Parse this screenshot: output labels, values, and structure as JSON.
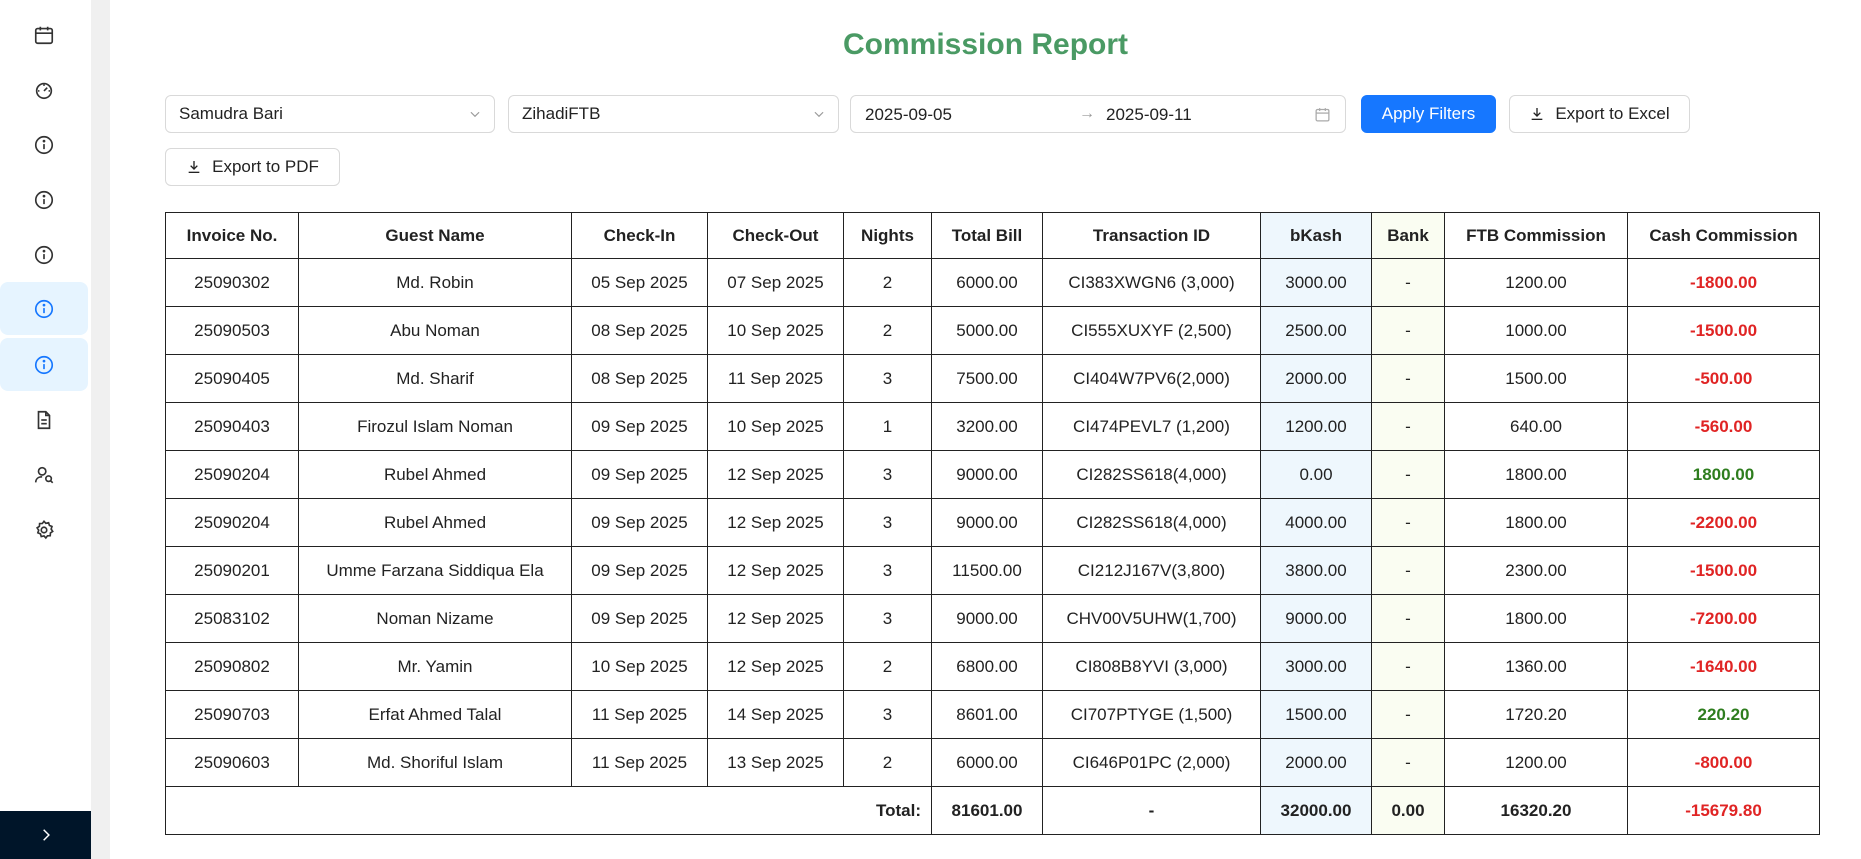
{
  "page": {
    "title": "Commission Report"
  },
  "filters": {
    "property": "Samudra Bari",
    "agent": "ZihadiFTB",
    "date_from": "2025-09-05",
    "date_arrow": "→",
    "date_to": "2025-09-11",
    "apply_label": "Apply Filters",
    "export_excel_label": "Export to Excel",
    "export_pdf_label": "Export to PDF"
  },
  "sidebar": {
    "items": [
      {
        "icon": "calendar-icon"
      },
      {
        "icon": "dashboard-icon"
      },
      {
        "icon": "info-icon"
      },
      {
        "icon": "info-icon"
      },
      {
        "icon": "info-icon"
      },
      {
        "icon": "info-icon",
        "active": true
      },
      {
        "icon": "info-icon",
        "active": true
      },
      {
        "icon": "file-text-icon"
      },
      {
        "icon": "user-search-icon"
      },
      {
        "icon": "settings-icon"
      }
    ],
    "footer_icon": "chevron-right-icon"
  },
  "table": {
    "headers": [
      "Invoice No.",
      "Guest Name",
      "Check-In",
      "Check-Out",
      "Nights",
      "Total Bill",
      "Transaction ID",
      "bKash",
      "Bank",
      "FTB Commission",
      "Cash Commission"
    ],
    "rows": [
      {
        "invoice": "25090302",
        "guest": "Md. Robin",
        "checkin": "05 Sep 2025",
        "checkout": "07 Sep 2025",
        "nights": "2",
        "total": "6000.00",
        "txn": "CI383XWGN6 (3,000)",
        "bkash": "3000.00",
        "bank": "-",
        "ftb": "1200.00",
        "cash": "-1800.00"
      },
      {
        "invoice": "25090503",
        "guest": "Abu Noman",
        "checkin": "08 Sep 2025",
        "checkout": "10 Sep 2025",
        "nights": "2",
        "total": "5000.00",
        "txn": "CI555XUXYF (2,500)",
        "bkash": "2500.00",
        "bank": "-",
        "ftb": "1000.00",
        "cash": "-1500.00"
      },
      {
        "invoice": "25090405",
        "guest": "Md. Sharif",
        "checkin": "08 Sep 2025",
        "checkout": "11 Sep 2025",
        "nights": "3",
        "total": "7500.00",
        "txn": "CI404W7PV6(2,000)",
        "bkash": "2000.00",
        "bank": "-",
        "ftb": "1500.00",
        "cash": "-500.00"
      },
      {
        "invoice": "25090403",
        "guest": "Firozul Islam Noman",
        "checkin": "09 Sep 2025",
        "checkout": "10 Sep 2025",
        "nights": "1",
        "total": "3200.00",
        "txn": "CI474PEVL7 (1,200)",
        "bkash": "1200.00",
        "bank": "-",
        "ftb": "640.00",
        "cash": "-560.00"
      },
      {
        "invoice": "25090204",
        "guest": "Rubel Ahmed",
        "checkin": "09 Sep 2025",
        "checkout": "12 Sep 2025",
        "nights": "3",
        "total": "9000.00",
        "txn": "CI282SS618(4,000)",
        "bkash": "0.00",
        "bank": "-",
        "ftb": "1800.00",
        "cash": "1800.00"
      },
      {
        "invoice": "25090204",
        "guest": "Rubel Ahmed",
        "checkin": "09 Sep 2025",
        "checkout": "12 Sep 2025",
        "nights": "3",
        "total": "9000.00",
        "txn": "CI282SS618(4,000)",
        "bkash": "4000.00",
        "bank": "-",
        "ftb": "1800.00",
        "cash": "-2200.00"
      },
      {
        "invoice": "25090201",
        "guest": "Umme Farzana Siddiqua Ela",
        "checkin": "09 Sep 2025",
        "checkout": "12 Sep 2025",
        "nights": "3",
        "total": "11500.00",
        "txn": "CI212J167V(3,800)",
        "bkash": "3800.00",
        "bank": "-",
        "ftb": "2300.00",
        "cash": "-1500.00"
      },
      {
        "invoice": "25083102",
        "guest": "Noman Nizame",
        "checkin": "09 Sep 2025",
        "checkout": "12 Sep 2025",
        "nights": "3",
        "total": "9000.00",
        "txn": "CHV00V5UHW(1,700)",
        "bkash": "9000.00",
        "bank": "-",
        "ftb": "1800.00",
        "cash": "-7200.00"
      },
      {
        "invoice": "25090802",
        "guest": "Mr. Yamin",
        "checkin": "10 Sep 2025",
        "checkout": "12 Sep 2025",
        "nights": "2",
        "total": "6800.00",
        "txn": "CI808B8YVI (3,000)",
        "bkash": "3000.00",
        "bank": "-",
        "ftb": "1360.00",
        "cash": "-1640.00"
      },
      {
        "invoice": "25090703",
        "guest": "Erfat Ahmed Talal",
        "checkin": "11 Sep 2025",
        "checkout": "14 Sep 2025",
        "nights": "3",
        "total": "8601.00",
        "txn": "CI707PTYGE (1,500)",
        "bkash": "1500.00",
        "bank": "-",
        "ftb": "1720.20",
        "cash": "220.20"
      },
      {
        "invoice": "25090603",
        "guest": "Md. Shoriful Islam",
        "checkin": "11 Sep 2025",
        "checkout": "13 Sep 2025",
        "nights": "2",
        "total": "6000.00",
        "txn": "CI646P01PC (2,000)",
        "bkash": "2000.00",
        "bank": "-",
        "ftb": "1200.00",
        "cash": "-800.00"
      }
    ],
    "totals": {
      "label": "Total:",
      "total": "81601.00",
      "txn": "-",
      "bkash": "32000.00",
      "bank": "0.00",
      "ftb": "16320.20",
      "cash": "-15679.80"
    }
  },
  "colors": {
    "accent": "#1677ff",
    "title": "#4a9a64",
    "negative": "#e02424",
    "positive": "#2e7d1e",
    "bkash_bg": "#eef7fd",
    "bank_bg": "#fafdf2",
    "sidebar_footer": "#001529"
  }
}
